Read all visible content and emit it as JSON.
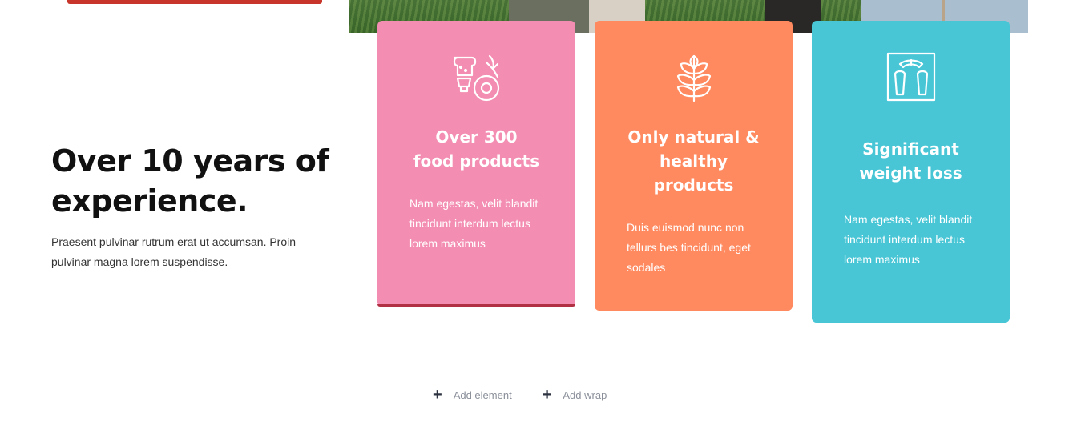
{
  "hero": {
    "headline": "Over 10 years of experience.",
    "intro": "Praesent pulvinar rutrum erat ut accumsan. Proin pulvinar magna lorem suspendisse."
  },
  "cards": [
    {
      "icon": "food-products-icon",
      "title": "Over 300\nfood products",
      "text": "Nam egestas, velit blandit tincidunt interdum lectus lorem maximus",
      "color": "#f38db1"
    },
    {
      "icon": "plant-leaves-icon",
      "title": "Only natural &\nhealthy\nproducts",
      "text": "Duis euismod nunc non tellurs bes tincidunt, eget sodales",
      "color": "#ff8a60"
    },
    {
      "icon": "weight-scale-icon",
      "title": "Significant\nweight loss",
      "text": "Nam egestas, velit blandit tincidunt interdum lectus lorem maximus",
      "color": "#48c6d6"
    }
  ],
  "builder": {
    "add_element": "Add element",
    "add_wrap": "Add wrap"
  },
  "colors": {
    "accent_red": "#c8362b",
    "headline": "#111111",
    "builder_text": "#8a8f99"
  }
}
